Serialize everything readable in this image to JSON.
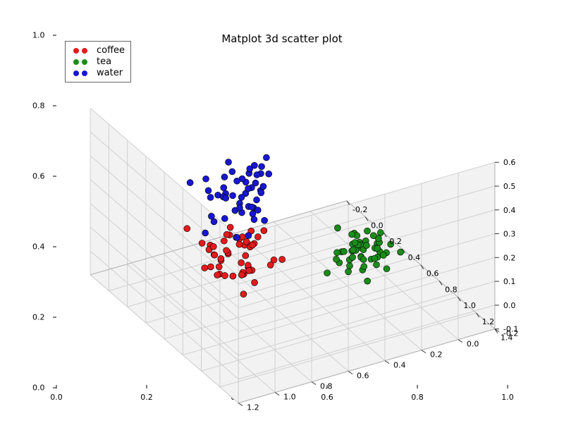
{
  "chart_data": {
    "type": "scatter",
    "title": "Matplot 3d scatter plot",
    "projection": "3d",
    "series": [
      {
        "name": "coffee",
        "color": "#e41a1c",
        "n": 50,
        "center": [
          1.0,
          1.0,
          0.35
        ],
        "spread": [
          0.18,
          0.18,
          0.1
        ]
      },
      {
        "name": "tea",
        "color": "#1a8c1a",
        "n": 50,
        "center": [
          0.55,
          0.1,
          0.0
        ],
        "spread": [
          0.18,
          0.14,
          0.06
        ]
      },
      {
        "name": "water",
        "color": "#1717d1",
        "n": 50,
        "center": [
          0.05,
          0.5,
          0.15
        ],
        "spread": [
          0.18,
          0.18,
          0.1
        ]
      }
    ],
    "axes": {
      "x": {
        "min": -0.2,
        "max": 1.4,
        "ticks": [
          -0.2,
          0.0,
          0.2,
          0.4,
          0.6,
          0.8,
          1.0,
          1.2,
          1.4
        ]
      },
      "y": {
        "min": -0.2,
        "max": 1.2,
        "ticks": [
          -0.2,
          0.0,
          0.2,
          0.4,
          0.6,
          0.8,
          1.0,
          1.2
        ]
      },
      "z": {
        "min": -0.1,
        "max": 0.6,
        "ticks": [
          -0.1,
          0.0,
          0.1,
          0.2,
          0.3,
          0.4,
          0.5,
          0.6
        ]
      }
    },
    "outer_axes": {
      "x": {
        "min": 0.0,
        "max": 1.0,
        "ticks": [
          0.0,
          0.2,
          0.4,
          0.6,
          0.8,
          1.0
        ]
      },
      "y": {
        "min": 0.0,
        "max": 1.0,
        "ticks": [
          0.0,
          0.2,
          0.4,
          0.6,
          0.8,
          1.0
        ]
      }
    },
    "legend": {
      "position": "upper-left",
      "entries": [
        "coffee",
        "tea",
        "water"
      ]
    }
  }
}
